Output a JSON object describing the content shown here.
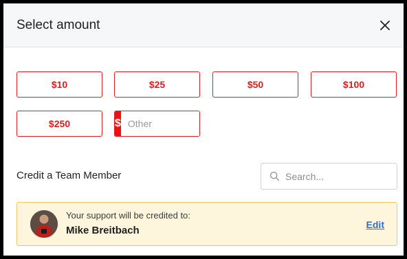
{
  "header": {
    "title": "Select amount",
    "close_icon": "close-icon"
  },
  "amounts": {
    "options": [
      "$10",
      "$25",
      "$50",
      "$100",
      "$250"
    ],
    "other": {
      "prefix": "$",
      "placeholder": "Other",
      "value": ""
    }
  },
  "credit": {
    "label": "Credit a Team Member",
    "search": {
      "placeholder": "Search...",
      "value": "",
      "icon": "search-icon"
    }
  },
  "banner": {
    "caption": "Your support will be credited to:",
    "name": "Mike Breitbach",
    "edit_label": "Edit"
  },
  "colors": {
    "accent": "#ee1111",
    "link": "#2a6fcf",
    "banner_bg": "#fef6dc",
    "banner_border": "#f2c65a"
  }
}
